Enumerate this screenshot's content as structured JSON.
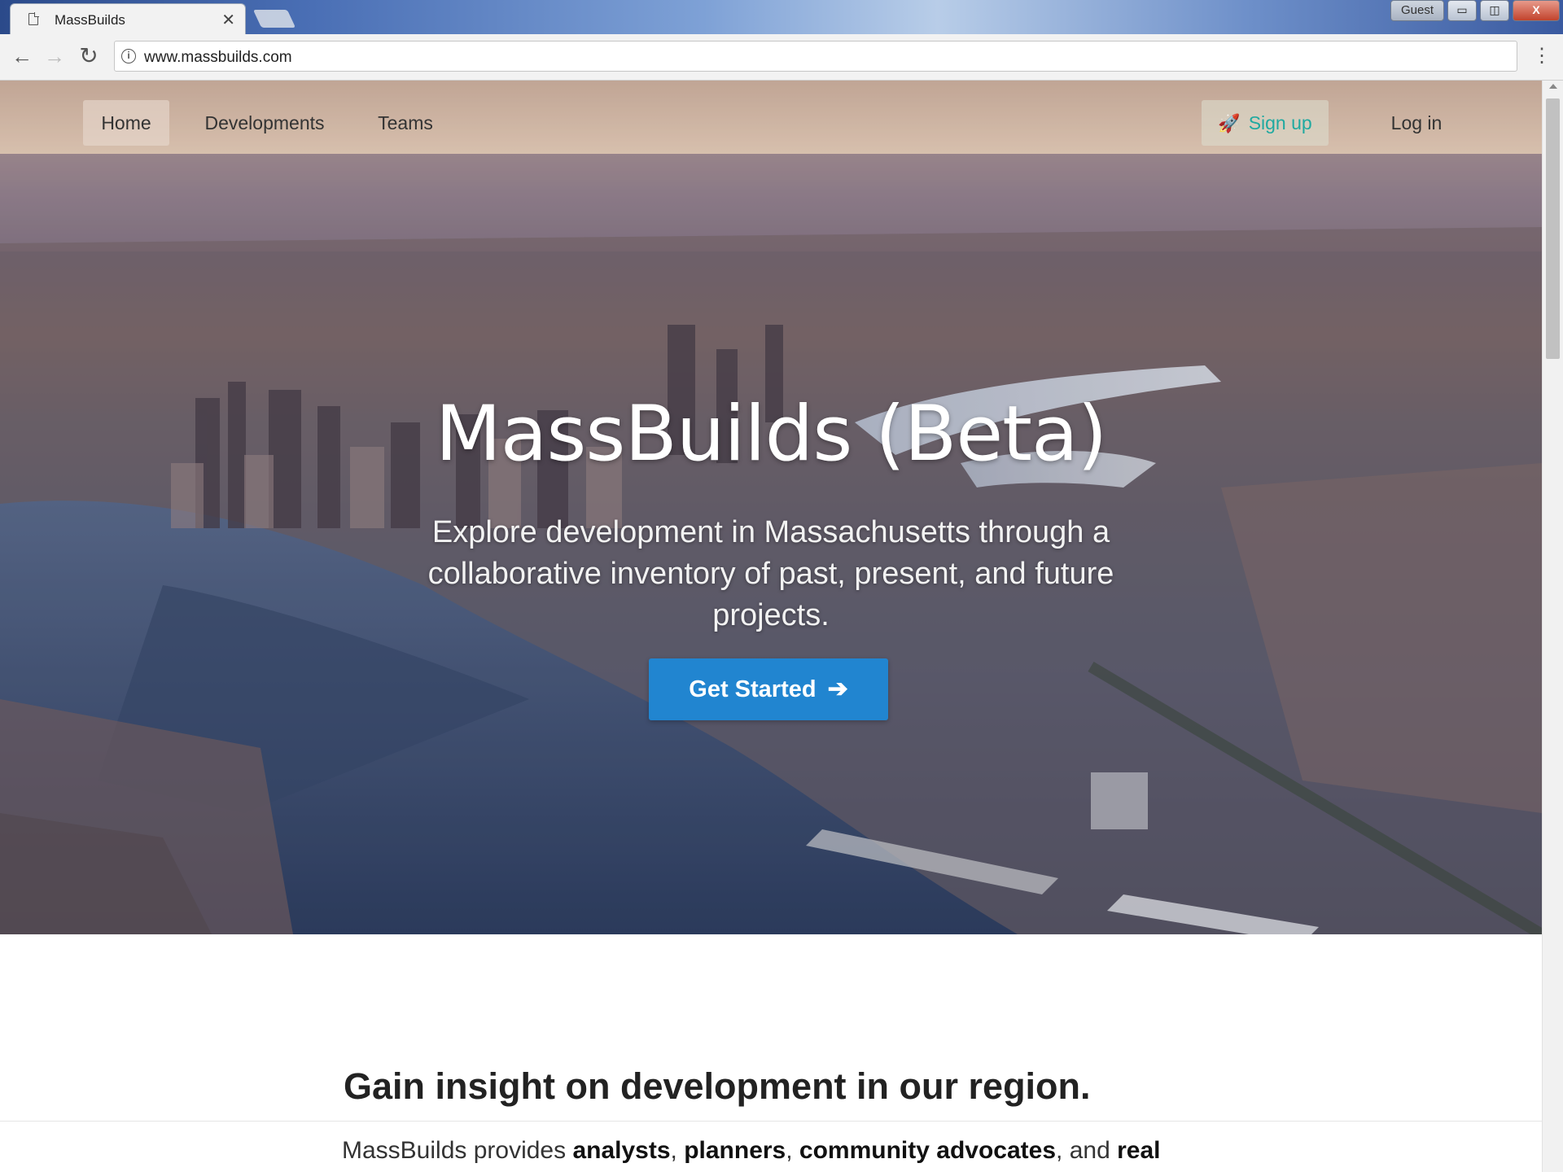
{
  "browser": {
    "tab_title": "MassBuilds",
    "url": "www.massbuilds.com",
    "guest_label": "Guest",
    "window_buttons": {
      "minimize": "▭",
      "maximize": "◫",
      "close": "X"
    }
  },
  "nav": {
    "home": "Home",
    "developments": "Developments",
    "teams": "Teams",
    "signup": "Sign up",
    "login": "Log in"
  },
  "hero": {
    "title": "MassBuilds (Beta)",
    "subtitle": "Explore development in Massachusetts through a collaborative inventory of past, present, and future projects.",
    "cta": "Get Started"
  },
  "section": {
    "title": "Gain insight on development in our region.",
    "text_parts": {
      "p1": "MassBuilds provides ",
      "b1": "analysts",
      "p2": ", ",
      "b2": "planners",
      "p3": ", ",
      "b3": "community advocates",
      "p4": ", and ",
      "b4": "real"
    }
  },
  "icons": {
    "tab": "page-icon",
    "close_tab": "close-icon",
    "back": "arrow-left-icon",
    "forward": "arrow-right-icon",
    "reload": "reload-icon",
    "info": "info-icon",
    "menu": "menu-dots-icon",
    "signup": "rocket-icon",
    "cta": "arrow-right-icon"
  },
  "colors": {
    "cta_bg": "#2185d0",
    "signup_text": "#1fa9a0"
  }
}
